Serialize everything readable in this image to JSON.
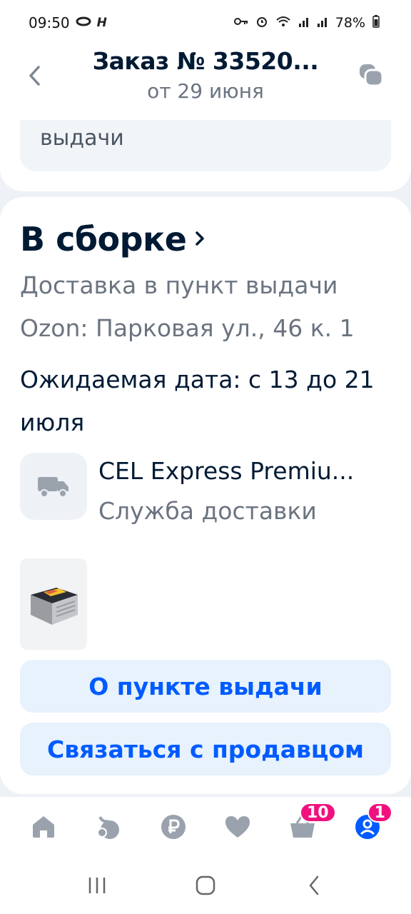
{
  "status_bar": {
    "time": "09:50",
    "battery": "78%"
  },
  "header": {
    "title": "Заказ № 33520...",
    "subtitle": "от 29 июня"
  },
  "top_card": {
    "text": "выдачи"
  },
  "order": {
    "status": "В сборке",
    "delivery_type": "Доставка в пункт выдачи",
    "address": "Ozon: Парковая ул., 46 к. 1",
    "expected_date": "Ожидаемая дата: с 13 до 21 июля",
    "service_name": "CEL Express Premiu...",
    "service_label": "Служба доставки",
    "pickup_button": "О пункте выдачи",
    "seller_button": "Связаться с продавцом"
  },
  "bottom_nav": {
    "items": [
      {
        "icon": "home-icon"
      },
      {
        "icon": "fresh-icon"
      },
      {
        "icon": "ruble-icon"
      },
      {
        "icon": "heart-icon"
      },
      {
        "icon": "cart-icon",
        "badge": "10"
      },
      {
        "icon": "profile-icon",
        "badge": "1"
      }
    ]
  },
  "colors": {
    "accent": "#005bff",
    "badge": "#f1117e",
    "button_bg": "#e7f2fd"
  }
}
